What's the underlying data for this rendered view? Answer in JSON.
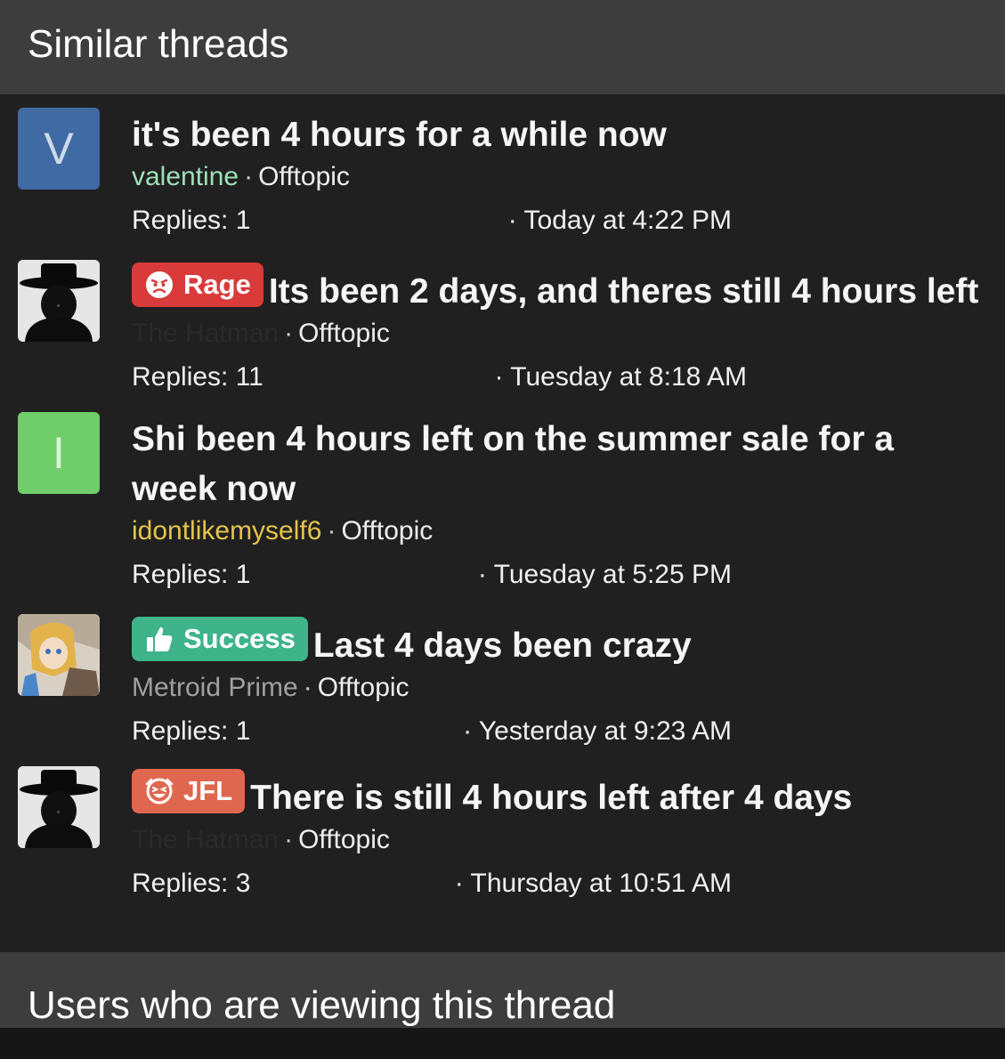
{
  "sections": {
    "similar_threads": "Similar threads",
    "viewers": "Users who are viewing this thread"
  },
  "threads": [
    {
      "avatar_letter": "V",
      "avatar_color": "#3f6aa3",
      "prefix": null,
      "title": "it's been 4 hours for a while now",
      "author": "valentine",
      "author_color": "#9fe0b8",
      "forum": "Offtopic",
      "replies": "Replies: 1",
      "date": "Today at 4:22 PM"
    },
    {
      "avatar_icon": "hatman-avatar",
      "prefix": {
        "label": "Rage",
        "color": "#d93a3a",
        "icon": "angry-face-icon"
      },
      "title": "Its been 2 days, and theres still 4 hours left",
      "author": "The Hatman",
      "author_color": "#2a2a2a",
      "forum": "Offtopic",
      "replies": "Replies: 11",
      "date": "Tuesday at 8:18 AM"
    },
    {
      "avatar_letter": "I",
      "avatar_color": "#6fcd6a",
      "prefix": null,
      "title": "Shi been 4 hours left on the summer sale for a week now",
      "author": "idontlikemyself6",
      "author_color": "#e4c44a",
      "forum": "Offtopic",
      "replies": "Replies: 1",
      "date": "Tuesday at 5:25 PM"
    },
    {
      "avatar_icon": "anime-character-avatar",
      "prefix": {
        "label": "Success",
        "color": "#3fb38a",
        "icon": "thumbs-up-icon"
      },
      "title": "Last 4 days been crazy",
      "author": "Metroid Prime",
      "author_color": "#a0a0a0",
      "forum": "Offtopic",
      "replies": "Replies: 1",
      "date": "Yesterday at 9:23 AM"
    },
    {
      "avatar_icon": "hatman-avatar",
      "prefix": {
        "label": "JFL",
        "color": "#e0674f",
        "icon": "laughing-face-icon"
      },
      "title": "There is still 4 hours left after 4 days",
      "author": "The Hatman",
      "author_color": "#2a2a2a",
      "forum": "Offtopic",
      "replies": "Replies: 3",
      "date": "Thursday at 10:51 AM"
    }
  ],
  "separator": "·"
}
